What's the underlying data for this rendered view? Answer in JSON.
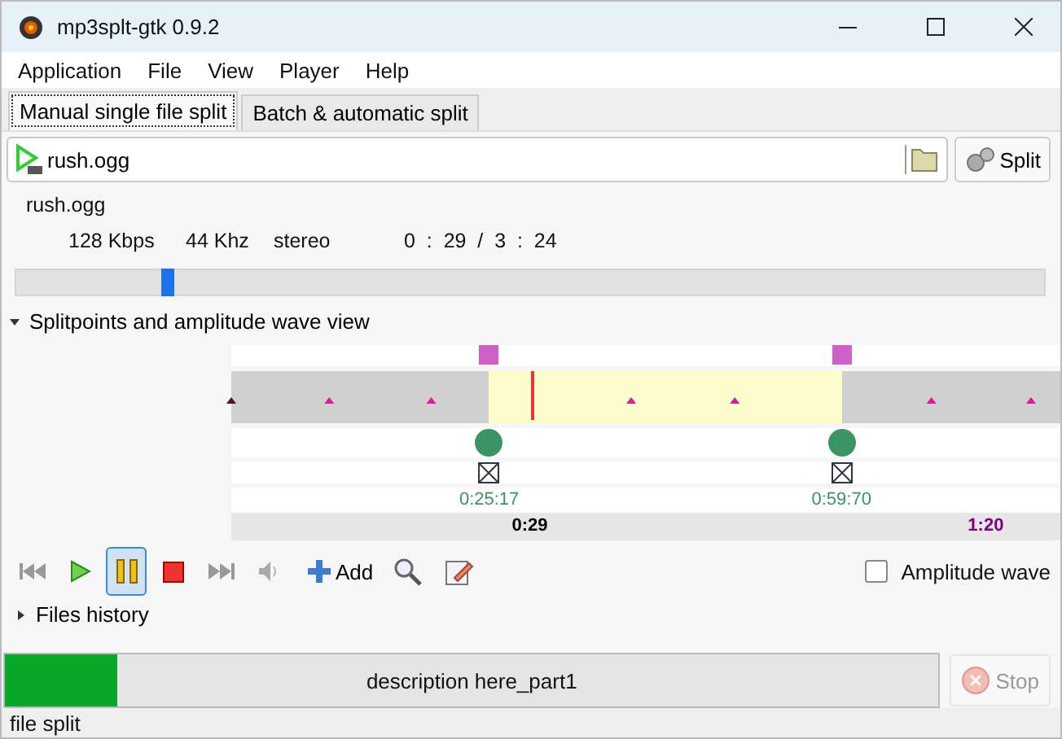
{
  "window": {
    "title": "mp3splt-gtk 0.9.2"
  },
  "menu": [
    "Application",
    "File",
    "View",
    "Player",
    "Help"
  ],
  "tabs": [
    {
      "label": "Manual single file split",
      "selected": true
    },
    {
      "label": "Batch & automatic split",
      "selected": false
    }
  ],
  "file_field": {
    "value": "rush.ogg"
  },
  "split_button": "Split",
  "file_info": {
    "name": "rush.ogg",
    "bitrate": "128 Kbps",
    "frequency": "44 Khz",
    "mode": "stereo",
    "time": "0  :  29  /  3  :  24"
  },
  "player_slider": {
    "level": 0.148
  },
  "wave_view": {
    "label": "Splitpoints and amplitude wave view",
    "expanded": true,
    "splitpoints": [
      {
        "time": "0:25:17"
      },
      {
        "time": "0:59:70"
      }
    ],
    "ruler": [
      {
        "label": "0:29",
        "color": "#000000"
      },
      {
        "label": "1:20",
        "color": "#800080"
      }
    ]
  },
  "toolbar": [
    {
      "kind": "previous",
      "selected": false
    },
    {
      "kind": "play",
      "selected": false
    },
    {
      "kind": "pause",
      "selected": true
    },
    {
      "kind": "stop",
      "selected": false
    },
    {
      "kind": "next",
      "selected": false
    },
    {
      "kind": "volume",
      "selected": false
    }
  ],
  "add_button": "Add",
  "amplitude_wave": {
    "label": "Amplitude wave",
    "checked": false
  },
  "files_history": {
    "label": "Files history",
    "expanded": false
  },
  "progress": {
    "level": 0.12,
    "text": "description here_part1"
  },
  "stop_button": {
    "label": "Stop",
    "disabled": true
  },
  "status_bar": "file split"
}
